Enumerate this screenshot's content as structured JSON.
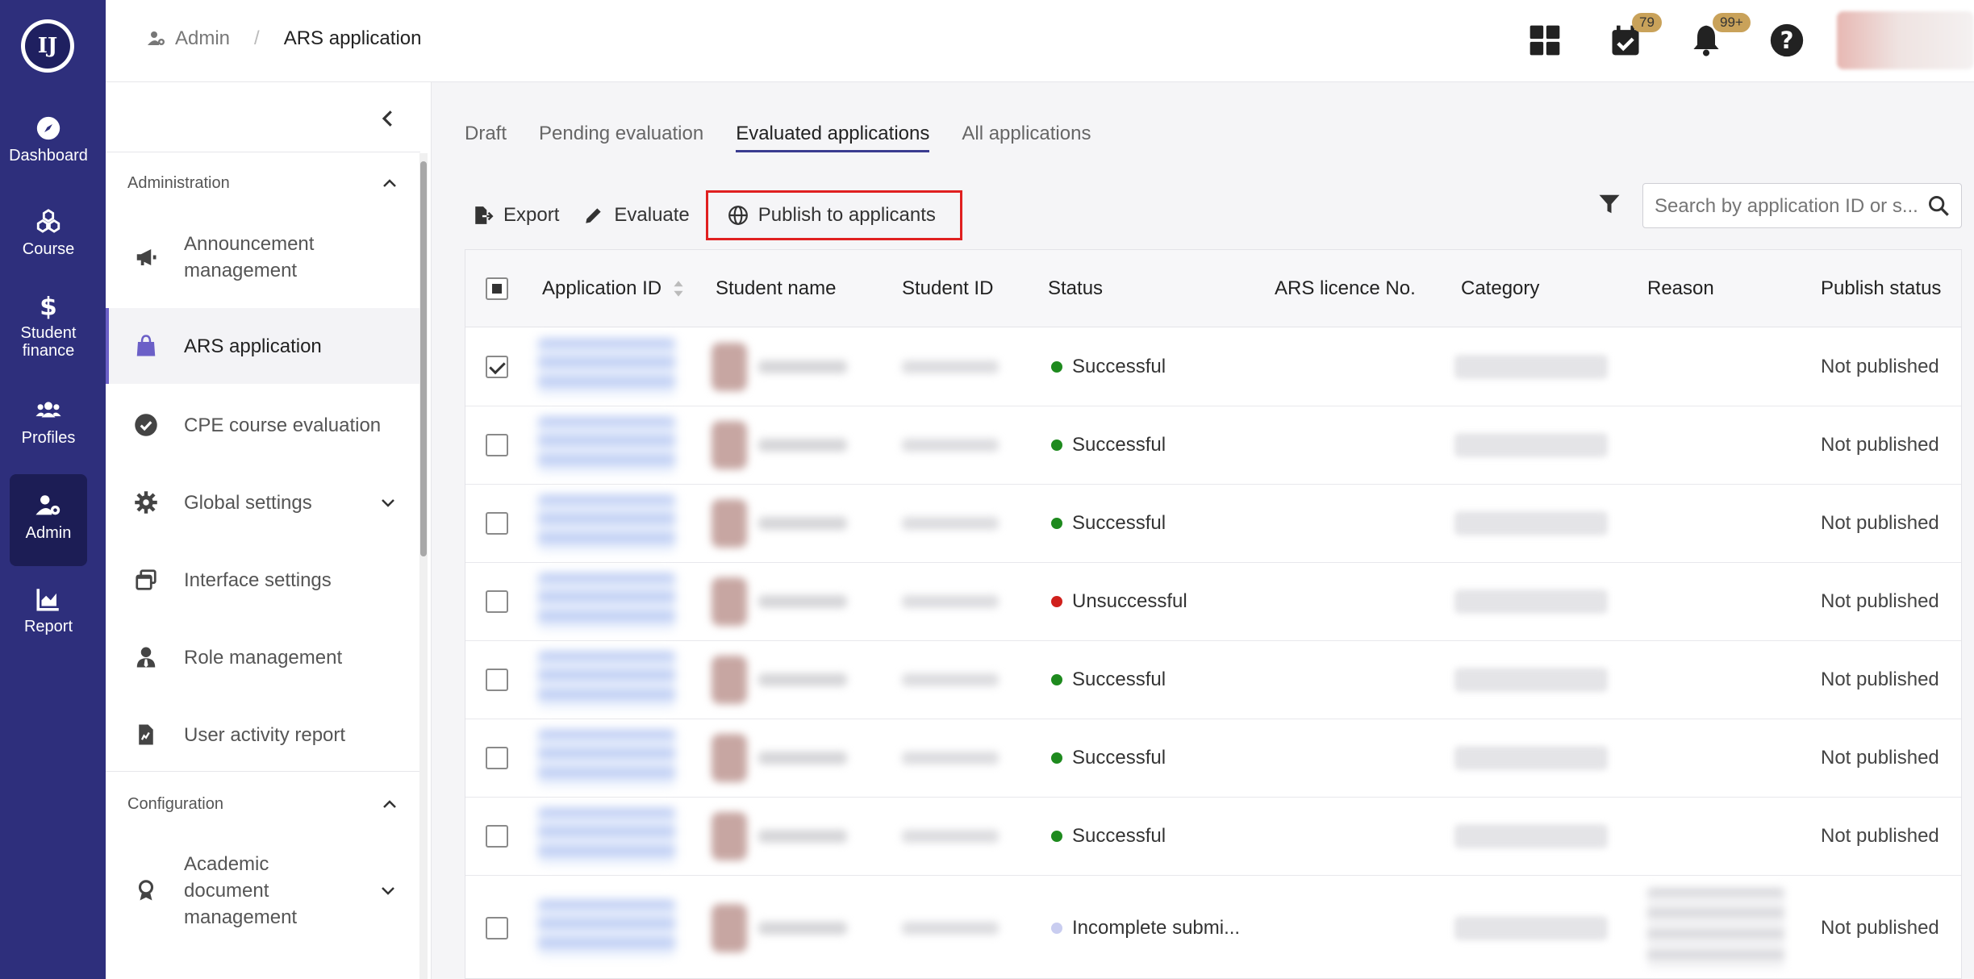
{
  "colors": {
    "rail": "#2e2f7c",
    "accent": "#6b5fc7",
    "success": "#1e8a1e",
    "fail": "#d0201c",
    "incomplete": "#c9cdf0",
    "badge": "#c9a25a",
    "highlight": "#e02020"
  },
  "rail": {
    "items": [
      {
        "label": "Dashboard",
        "icon": "compass-icon"
      },
      {
        "label": "Course",
        "icon": "cubes-icon"
      },
      {
        "label": "Student finance",
        "icon": "dollar-icon"
      },
      {
        "label": "Profiles",
        "icon": "users-icon"
      },
      {
        "label": "Admin",
        "icon": "user-gear-icon"
      },
      {
        "label": "Report",
        "icon": "chart-icon"
      }
    ]
  },
  "breadcrumb": {
    "parent": "Admin",
    "current": "ARS application"
  },
  "topbar": {
    "tasks_badge": "79",
    "notifications_badge": "99+"
  },
  "sidebar": {
    "administration": "Administration",
    "configuration": "Configuration",
    "items": [
      {
        "label": "Announcement management"
      },
      {
        "label": "ARS application"
      },
      {
        "label": "CPE course evaluation"
      },
      {
        "label": "Global settings"
      },
      {
        "label": "Interface settings"
      },
      {
        "label": "Role management"
      },
      {
        "label": "User activity report"
      },
      {
        "label": "Academic document management"
      }
    ]
  },
  "tabs": [
    "Draft",
    "Pending evaluation",
    "Evaluated applications",
    "All applications"
  ],
  "toolbar": {
    "export": "Export",
    "evaluate": "Evaluate",
    "publish": "Publish to applicants"
  },
  "search": {
    "placeholder": "Search by application ID or s..."
  },
  "table": {
    "columns": [
      "Application ID",
      "Student name",
      "Student ID",
      "Status",
      "ARS licence No.",
      "Category",
      "Reason",
      "Publish status"
    ],
    "rows": [
      {
        "checked": true,
        "status": "Successful",
        "status_color": "#1e8a1e",
        "publish": "Not published"
      },
      {
        "checked": false,
        "status": "Successful",
        "status_color": "#1e8a1e",
        "publish": "Not published"
      },
      {
        "checked": false,
        "status": "Successful",
        "status_color": "#1e8a1e",
        "publish": "Not published"
      },
      {
        "checked": false,
        "status": "Unsuccessful",
        "status_color": "#d0201c",
        "publish": "Not published"
      },
      {
        "checked": false,
        "status": "Successful",
        "status_color": "#1e8a1e",
        "publish": "Not published"
      },
      {
        "checked": false,
        "status": "Successful",
        "status_color": "#1e8a1e",
        "publish": "Not published"
      },
      {
        "checked": false,
        "status": "Successful",
        "status_color": "#1e8a1e",
        "publish": "Not published"
      },
      {
        "checked": false,
        "status": "Incomplete submi...",
        "status_color": "#c9cdf0",
        "publish": "Not published"
      }
    ]
  }
}
